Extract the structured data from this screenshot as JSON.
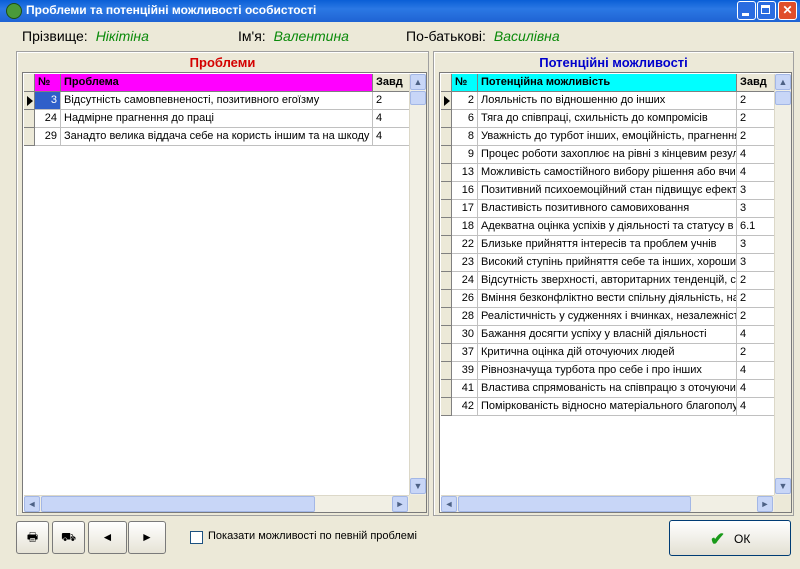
{
  "window": {
    "title": "Проблеми та потенційні можливості особистості"
  },
  "person": {
    "surname_label": "Прізвище:",
    "surname": "Нікітіна",
    "name_label": "Ім'я:",
    "name": "Валентина",
    "patronymic_label": "По-батькові:",
    "patronymic": "Василівна"
  },
  "problems": {
    "title": "Проблеми",
    "title_color": "#d40000",
    "header_bg": "#ff00ff",
    "columns": [
      "№",
      "Проблема",
      "Завд"
    ],
    "rows": [
      {
        "num": "3",
        "text": "Відсутність самовпевненості, позитивного егоїзму",
        "task": "2"
      },
      {
        "num": "24",
        "text": "Надмірне прагнення до праці",
        "task": "4"
      },
      {
        "num": "29",
        "text": "Занадто велика віддача себе на користь іншим та на шкоду с",
        "task": "4"
      }
    ]
  },
  "opportunities": {
    "title": "Потенційні можливості",
    "title_color": "#0000cc",
    "header_bg": "#00ffff",
    "columns": [
      "№",
      "Потенційна можливість",
      "Завд"
    ],
    "rows": [
      {
        "num": "2",
        "text": "Лояльність по відношенню до інших",
        "task": "2"
      },
      {
        "num": "6",
        "text": "Тяга до співпраці, схильність до компромісів",
        "task": "2"
      },
      {
        "num": "8",
        "text": "Уважність до турбот інших, емоційність, прагнення",
        "task": "2"
      },
      {
        "num": "9",
        "text": "Процес роботи захоплює на рівні з кінцевим резул",
        "task": "4"
      },
      {
        "num": "13",
        "text": "Можливість самостійного вибору рішення або вчин",
        "task": "4"
      },
      {
        "num": "16",
        "text": "Позитивний психоемоційний стан підвищує ефекти",
        "task": "3"
      },
      {
        "num": "17",
        "text": "Властивість позитивного самовиховання",
        "task": "3"
      },
      {
        "num": "18",
        "text": "Адекватна оцінка успіхів у діяльності та статусу в г",
        "task": "6.1"
      },
      {
        "num": "22",
        "text": "Близьке прийняття інтересів та проблем учнів",
        "task": "3"
      },
      {
        "num": "23",
        "text": "Високий ступінь прийняття себе та інших, хороший",
        "task": "3"
      },
      {
        "num": "24",
        "text": "Відсутність зверхності, авторитарних тенденцій, сх",
        "task": "2"
      },
      {
        "num": "26",
        "text": "Вміння безконфліктно вести спільну діяльність, на",
        "task": "2"
      },
      {
        "num": "28",
        "text": "Реалістичність у судженнях і вчинках, незалежніст",
        "task": "2"
      },
      {
        "num": "30",
        "text": "Бажання досягти успіху у власній діяльності",
        "task": "4"
      },
      {
        "num": "37",
        "text": "Критична оцінка дій оточуючих людей",
        "task": "2"
      },
      {
        "num": "39",
        "text": "Рівнозначуща турбота про себе і про інших",
        "task": "4"
      },
      {
        "num": "41",
        "text": "Властива спрямованість на співпрацю з оточуючи",
        "task": "4"
      },
      {
        "num": "42",
        "text": "Поміркованість відносно матеріального благополу",
        "task": "4"
      }
    ]
  },
  "toolbar": {
    "print_icon": "printer-icon",
    "export_icon": "export-icon",
    "prev_label": "◄",
    "next_label": "►",
    "checkbox_label": "Показати можливості по певній проблемі",
    "ok_label": "ОК",
    "ok_icon": "✔"
  }
}
